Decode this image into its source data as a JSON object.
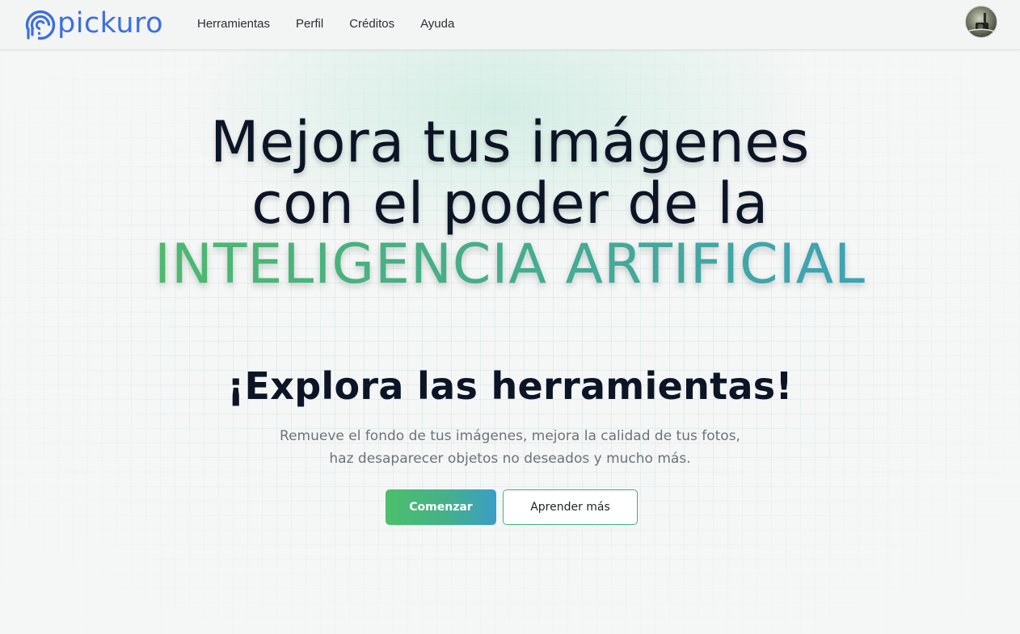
{
  "brand": {
    "name": "pickuro",
    "logo_icon": "concentric-arc-logo-icon",
    "color": "#3d6fe0"
  },
  "nav": {
    "items": [
      {
        "label": "Herramientas"
      },
      {
        "label": "Perfil"
      },
      {
        "label": "Créditos"
      },
      {
        "label": "Ayuda"
      }
    ]
  },
  "user": {
    "avatar_icon": "user-avatar-photo"
  },
  "hero": {
    "title_line1": "Mejora tus imágenes",
    "title_line2": "con el poder de la",
    "title_highlight": "INTELIGENCIA ARTIFICIAL",
    "subtitle": "¡Explora las herramientas!",
    "description": "Remueve el fondo de tus imágenes, mejora la calidad de tus fotos, haz desaparecer objetos no deseados y mucho más.",
    "primary_button": "Comenzar",
    "secondary_button": "Aprender más"
  },
  "colors": {
    "gradient_start": "#4cc06a",
    "gradient_end": "#3a9ec6",
    "text_dark": "#0b1526",
    "text_muted": "#6c737a"
  }
}
